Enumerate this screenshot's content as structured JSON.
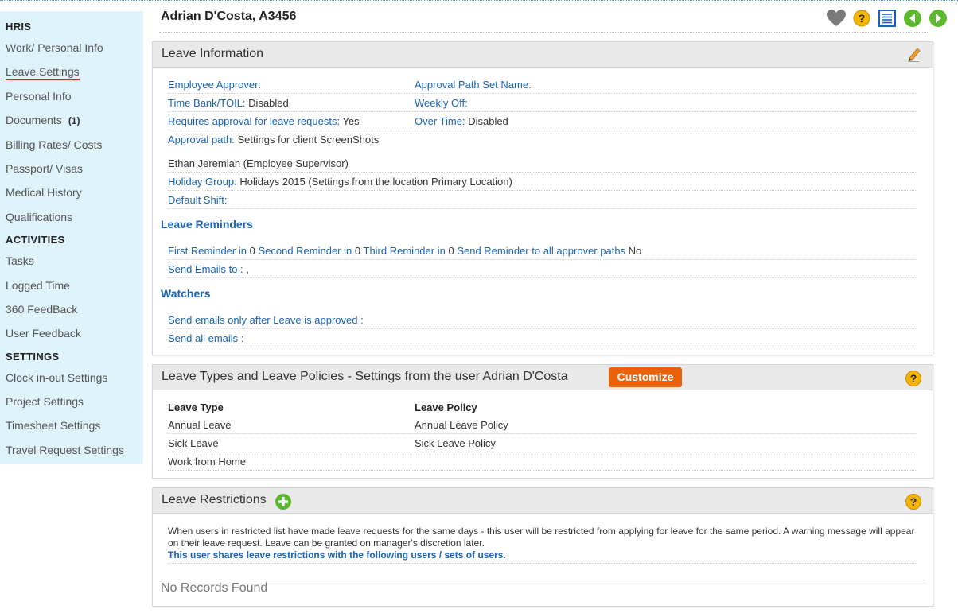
{
  "sidebar": {
    "sections": [
      {
        "heading": "HRIS",
        "items": [
          {
            "label": "Work/ Personal Info"
          },
          {
            "label": "Leave Settings",
            "active": true
          },
          {
            "label": "Personal Info"
          },
          {
            "label": "Documents",
            "count": "(1)"
          },
          {
            "label": "Billing Rates/ Costs"
          },
          {
            "label": "Passport/ Visas"
          },
          {
            "label": "Medical History"
          },
          {
            "label": "Qualifications"
          }
        ]
      },
      {
        "heading": "ACTIVITIES",
        "items": [
          {
            "label": "Tasks"
          },
          {
            "label": "Logged Time"
          },
          {
            "label": "360 FeedBack"
          },
          {
            "label": "User Feedback"
          }
        ]
      },
      {
        "heading": "SETTINGS",
        "items": [
          {
            "label": "Clock in-out Settings"
          },
          {
            "label": "Project Settings"
          },
          {
            "label": "Timesheet Settings"
          },
          {
            "label": "Travel Request Settings"
          }
        ]
      }
    ]
  },
  "header": {
    "title": "Adrian D'Costa, A3456",
    "icons": [
      "heart-icon",
      "help-icon",
      "list-icon",
      "previous-icon",
      "next-icon"
    ],
    "help_glyph": "?"
  },
  "leave_info": {
    "title": "Leave Information",
    "employee_approver_label": "Employee Approver:",
    "approval_path_set_label": "Approval Path Set Name:",
    "time_bank_label": "Time Bank/TOIL:",
    "time_bank_value": "Disabled",
    "weekly_off_label": "Weekly Off:",
    "requires_approval_label": "Requires approval for leave requests:",
    "requires_approval_value": "Yes",
    "over_time_label": "Over Time:",
    "over_time_value": "Disabled",
    "approval_path_label": "Approval path:",
    "approval_path_value": "Settings for client ScreenShots",
    "supervisor_text": "Ethan Jeremiah (Employee Supervisor)",
    "holiday_group_label": "Holiday Group:",
    "holiday_group_value": "Holidays 2015 (Settings from the location Primary Location)",
    "default_shift_label": "Default Shift:",
    "reminders_heading": "Leave Reminders",
    "first_reminder_label": "First Reminder in",
    "first_reminder_value": "0",
    "second_reminder_label": "Second Reminder in",
    "second_reminder_value": "0",
    "third_reminder_label": "Third Reminder in",
    "third_reminder_value": "0",
    "send_all_paths_label": "Send Reminder to all approver paths",
    "send_all_paths_value": "No",
    "send_emails_label": "Send Emails to :",
    "send_emails_value": ",",
    "watchers_heading": "Watchers",
    "emails_after_approved_label": "Send emails only after Leave is approved :",
    "send_all_emails_label": "Send all emails :"
  },
  "leave_types": {
    "title": "Leave Types and Leave Policies - Settings from the user Adrian D'Costa",
    "customize_label": "Customize",
    "col_type": "Leave Type",
    "col_policy": "Leave Policy",
    "rows": [
      {
        "type": "Annual Leave",
        "policy": "Annual Leave Policy"
      },
      {
        "type": "Sick Leave",
        "policy": "Sick Leave Policy"
      },
      {
        "type": "Work from Home",
        "policy": ""
      }
    ]
  },
  "restrictions": {
    "title": "Leave Restrictions",
    "description": "When users in restricted list have made leave requests for the same days - this user will be restricted from applying for leave for the same period. A warning message will appear on their leave request. Leave can be granted on manager's discretion later.",
    "shares_text": "This user shares leave restrictions with the following users / sets of users.",
    "empty_text": "No Records Found"
  },
  "colors": {
    "sidebar_bg": "#dff3fa",
    "link": "#1b63b8",
    "customize": "#e8610b",
    "help": "#f5b400",
    "nav_green": "#5cb82e"
  }
}
